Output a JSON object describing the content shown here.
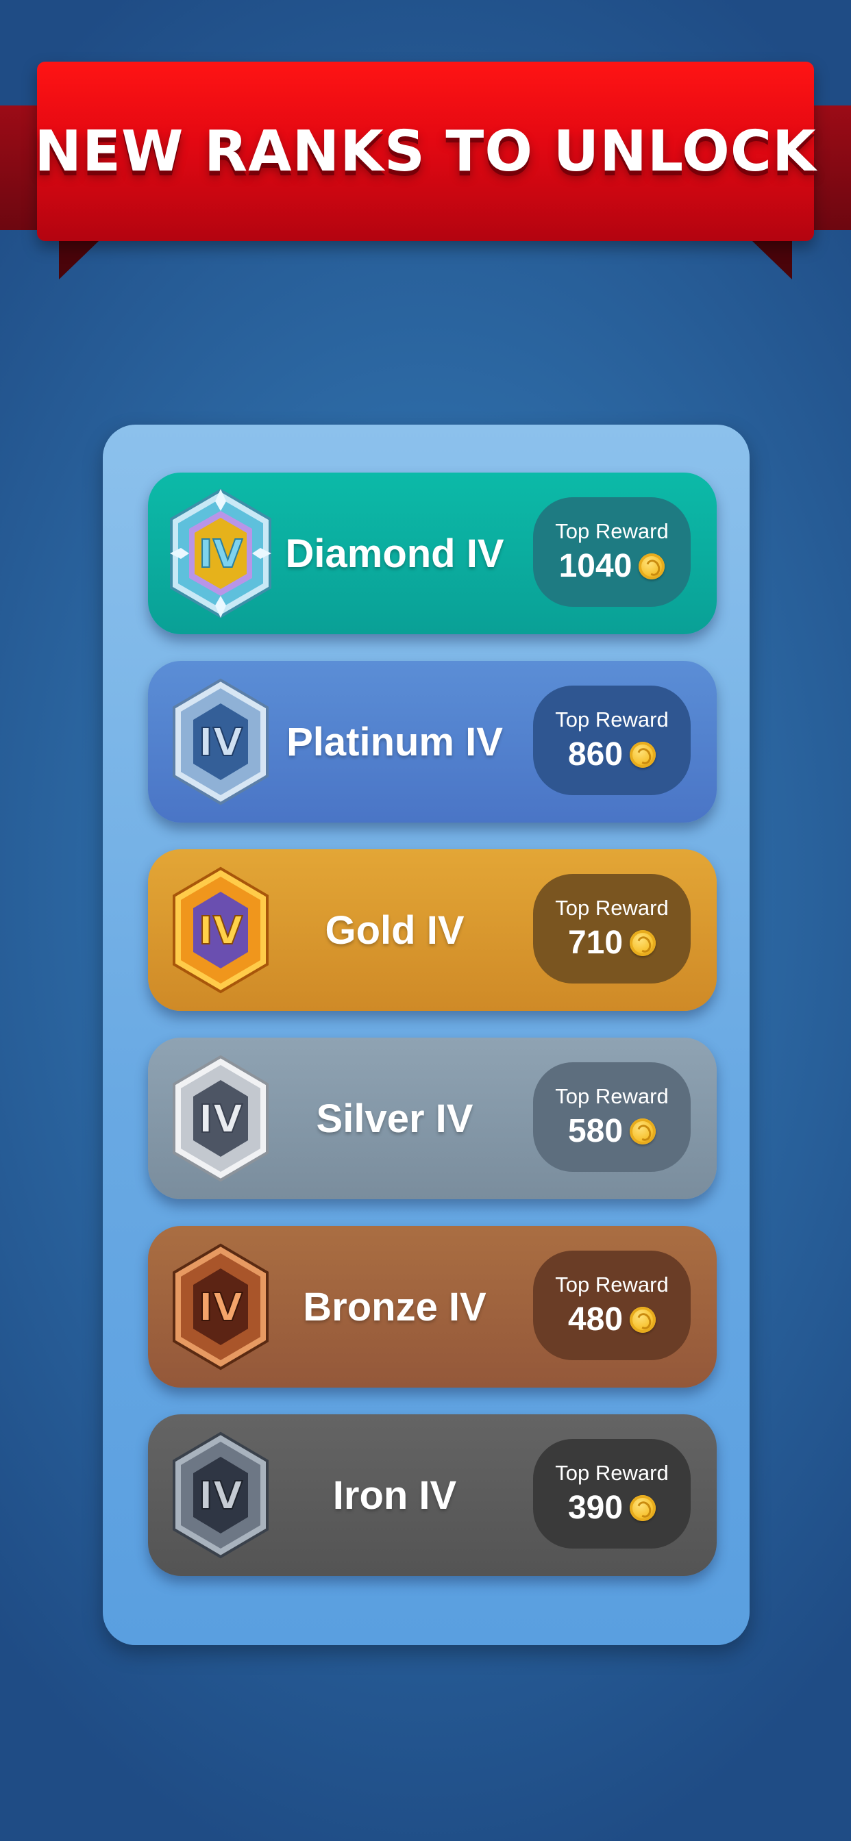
{
  "banner": {
    "title": "NEW RANKS TO UNLOCK"
  },
  "ranks": [
    {
      "name": "Diamond IV",
      "badge_numeral": "IV",
      "reward_label": "Top Reward",
      "reward_value": "1040",
      "badge_icon": "diamond-rank-icon",
      "color": "#0aa89b"
    },
    {
      "name": "Platinum IV",
      "badge_numeral": "IV",
      "reward_label": "Top Reward",
      "reward_value": "860",
      "badge_icon": "platinum-rank-icon",
      "color": "#5282cf"
    },
    {
      "name": "Gold IV",
      "badge_numeral": "IV",
      "reward_label": "Top Reward",
      "reward_value": "710",
      "badge_icon": "gold-rank-icon",
      "color": "#d9972d"
    },
    {
      "name": "Silver IV",
      "badge_numeral": "IV",
      "reward_label": "Top Reward",
      "reward_value": "580",
      "badge_icon": "silver-rank-icon",
      "color": "#8597a7"
    },
    {
      "name": "Bronze IV",
      "badge_numeral": "IV",
      "reward_label": "Top Reward",
      "reward_value": "480",
      "badge_icon": "bronze-rank-icon",
      "color": "#9e623e"
    },
    {
      "name": "Iron IV",
      "badge_numeral": "IV",
      "reward_label": "Top Reward",
      "reward_value": "390",
      "badge_icon": "iron-rank-icon",
      "color": "#5c5c5c"
    }
  ],
  "coin_icon": "gold-coin-icon"
}
